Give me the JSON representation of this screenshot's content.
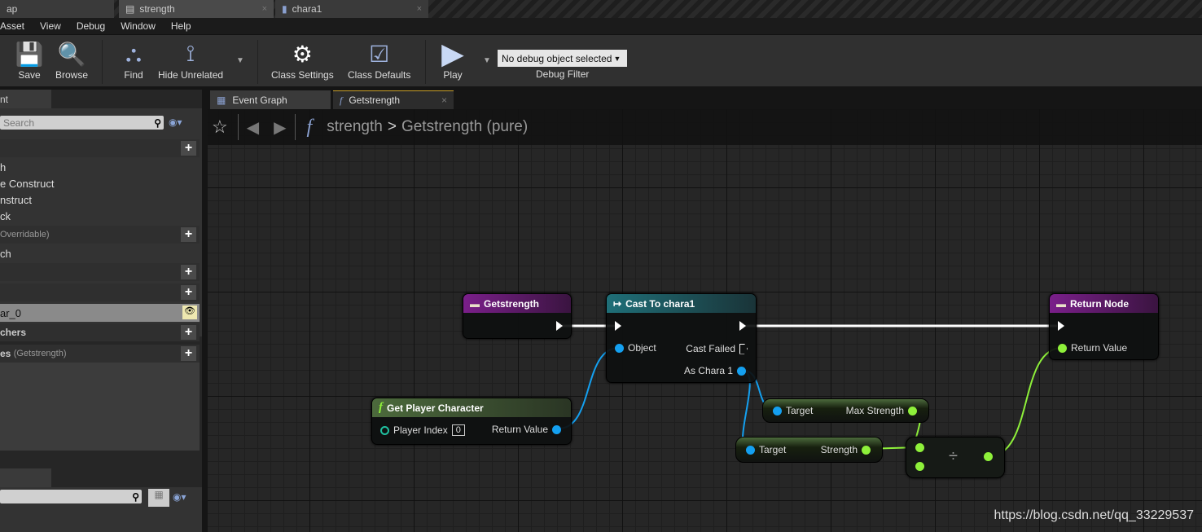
{
  "doc_tabs": [
    {
      "label": "ap",
      "active": false
    },
    {
      "label": "strength",
      "active": true
    },
    {
      "label": "chara1",
      "active": false
    }
  ],
  "menu": [
    "Asset",
    "View",
    "Debug",
    "Window",
    "Help"
  ],
  "toolbar": {
    "save": "Save",
    "browse": "Browse",
    "find": "Find",
    "hide_unrelated": "Hide Unrelated",
    "class_settings": "Class Settings",
    "class_defaults": "Class Defaults",
    "play": "Play",
    "debug_object": "No debug object selected",
    "debug_filter": "Debug Filter"
  },
  "my_blueprint": {
    "tab": "nt",
    "search_placeholder": "Search",
    "items": {
      "graph_header": "",
      "e1": "h",
      "e2": "e Construct",
      "e3": "nstruct",
      "e4": "ck",
      "functions": "Overridable)",
      "f1": "ch",
      "macros": "",
      "variables": "",
      "var1": "ar_0",
      "dispatchers": "chers",
      "locals_bold": "es",
      "locals": "(Getstrength)"
    }
  },
  "graph_tabs": [
    {
      "label": "Event Graph"
    },
    {
      "label": "Getstrength"
    }
  ],
  "breadcrumb": {
    "root": "strength",
    "separator": ">",
    "current": "Getstrength (pure)"
  },
  "nodes": {
    "entry": {
      "title": "Getstrength"
    },
    "cast": {
      "title": "Cast To chara1",
      "object": "Object",
      "cast_failed": "Cast Failed",
      "as": "As Chara 1"
    },
    "gpc": {
      "title": "Get Player Character",
      "player_index": "Player Index",
      "player_index_value": "0",
      "return_value": "Return Value"
    },
    "max": {
      "target": "Target",
      "out": "Max Strength"
    },
    "str": {
      "target": "Target",
      "out": "Strength"
    },
    "div": {
      "symbol": "÷"
    },
    "ret": {
      "title": "Return Node",
      "return_value": "Return Value"
    }
  },
  "colors": {
    "function_entry": "#7a1f8a",
    "cast": "#1f6f78",
    "pure_function": "#4c6a3c",
    "object_pin": "#14a0f0",
    "float_pin": "#8ef03a"
  },
  "watermark": "https://blog.csdn.net/qq_33229537"
}
